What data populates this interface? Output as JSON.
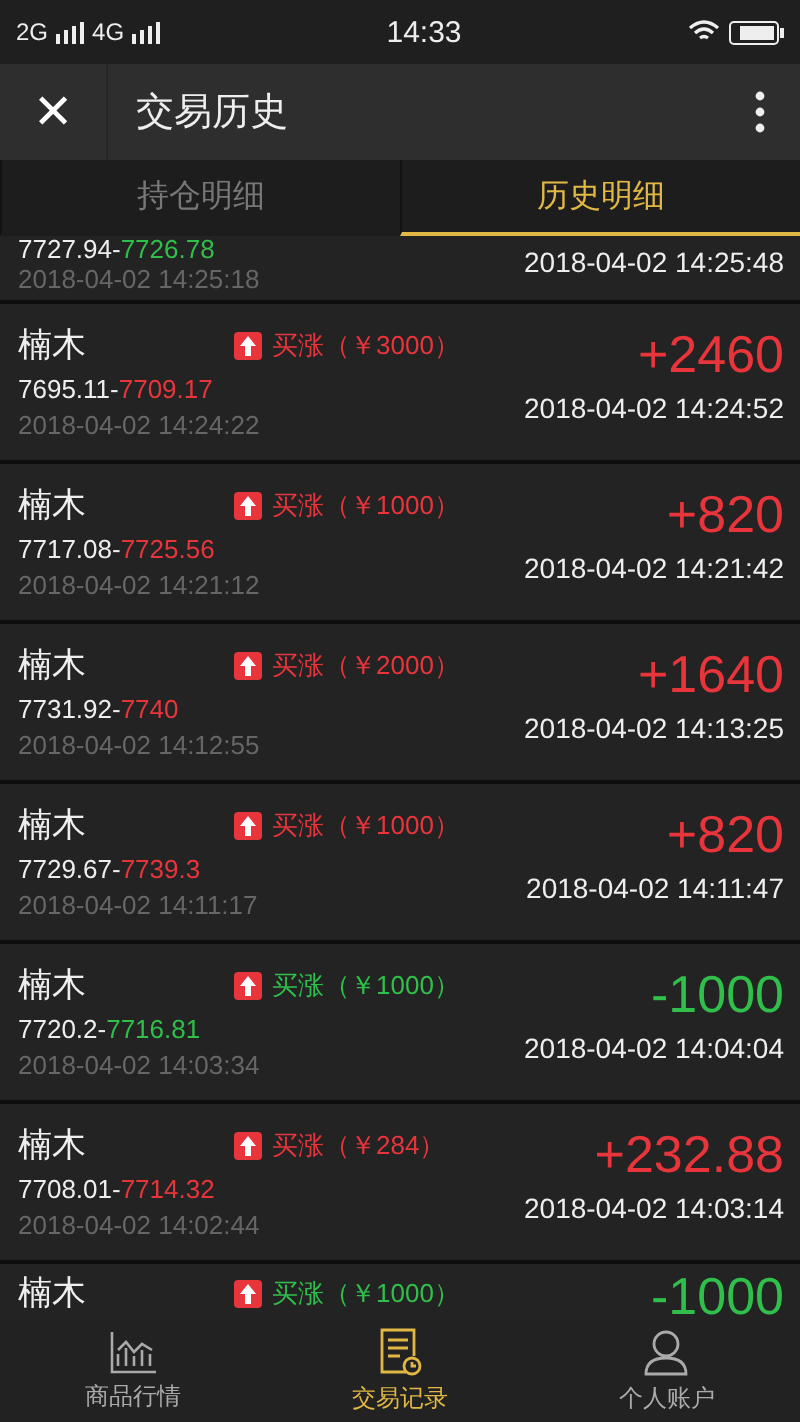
{
  "status_bar": {
    "network_1": "2G",
    "network_2": "4G",
    "time": "14:33"
  },
  "header": {
    "close": "✕",
    "title": "交易历史"
  },
  "tabs": [
    {
      "label": "持仓明细",
      "selected": false
    },
    {
      "label": "历史明细",
      "selected": true
    }
  ],
  "trades": [
    {
      "kind": "loss",
      "open_price": "7727.94-",
      "close_price": "7726.78",
      "open_time": "2018-04-02 14:25:18",
      "close_time": "2018-04-02 14:25:48"
    },
    {
      "kind": "gain",
      "name": "楠木",
      "order": "买涨（￥3000）",
      "amount": "+2460",
      "open_price": "7695.11-",
      "close_price": "7709.17",
      "open_time": "2018-04-02 14:24:22",
      "close_time": "2018-04-02 14:24:52"
    },
    {
      "kind": "gain",
      "name": "楠木",
      "order": "买涨（￥1000）",
      "amount": "+820",
      "open_price": "7717.08-",
      "close_price": "7725.56",
      "open_time": "2018-04-02 14:21:12",
      "close_time": "2018-04-02 14:21:42"
    },
    {
      "kind": "gain",
      "name": "楠木",
      "order": "买涨（￥2000）",
      "amount": "+1640",
      "open_price": "7731.92-",
      "close_price": "7740",
      "open_time": "2018-04-02 14:12:55",
      "close_time": "2018-04-02 14:13:25"
    },
    {
      "kind": "gain",
      "name": "楠木",
      "order": "买涨（￥1000）",
      "amount": "+820",
      "open_price": "7729.67-",
      "close_price": "7739.3",
      "open_time": "2018-04-02 14:11:17",
      "close_time": "2018-04-02 14:11:47"
    },
    {
      "kind": "loss",
      "name": "楠木",
      "order": "买涨（￥1000）",
      "amount": "-1000",
      "open_price": "7720.2-",
      "close_price": "7716.81",
      "open_time": "2018-04-02 14:03:34",
      "close_time": "2018-04-02 14:04:04"
    },
    {
      "kind": "gain",
      "name": "楠木",
      "order": "买涨（￥284）",
      "amount": "+232.88",
      "open_price": "7708.01-",
      "close_price": "7714.32",
      "open_time": "2018-04-02 14:02:44",
      "close_time": "2018-04-02 14:03:14"
    },
    {
      "kind": "loss",
      "name": "楠木",
      "order": "买涨（￥1000）",
      "amount": "-1000"
    }
  ],
  "bottom_nav": [
    {
      "label": "商品行情",
      "kind": "chart",
      "selected": false
    },
    {
      "label": "交易记录",
      "kind": "record",
      "selected": true
    },
    {
      "label": "个人账户",
      "kind": "person",
      "selected": false
    }
  ]
}
